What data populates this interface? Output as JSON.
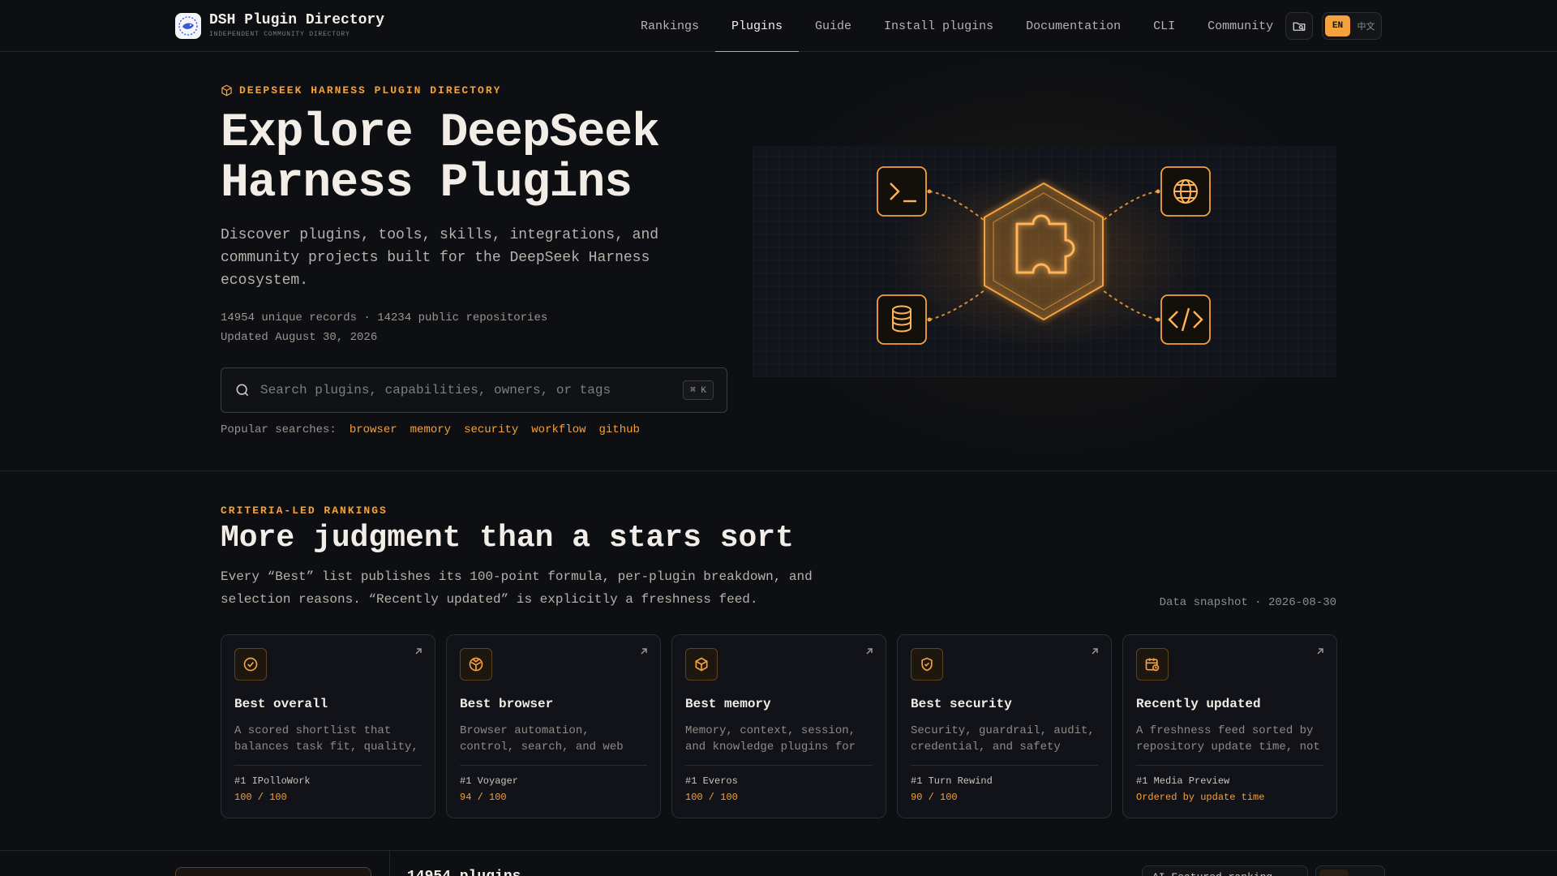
{
  "header": {
    "brand_title": "DSH Plugin Directory",
    "brand_subtitle": "INDEPENDENT COMMUNITY DIRECTORY",
    "nav": [
      {
        "label": "Rankings",
        "active": false
      },
      {
        "label": "Plugins",
        "active": true
      },
      {
        "label": "Guide",
        "active": false
      },
      {
        "label": "Install plugins",
        "active": false
      },
      {
        "label": "Documentation",
        "active": false
      },
      {
        "label": "CLI",
        "active": false
      },
      {
        "label": "Community",
        "active": false
      }
    ],
    "lang": {
      "active": "EN",
      "other": "中文"
    }
  },
  "hero": {
    "eyebrow": "DEEPSEEK HARNESS PLUGIN DIRECTORY",
    "title": "Explore DeepSeek Harness Plugins",
    "description": "Discover plugins, tools, skills, integrations, and community projects built for the DeepSeek Harness ecosystem.",
    "stats": "14954 unique records · 14234 public repositories",
    "updated": "Updated August 30, 2026",
    "search_placeholder": "Search plugins, capabilities, owners, or tags",
    "search_shortcut": "⌘ K",
    "popular_label": "Popular searches:",
    "popular": [
      "browser",
      "memory",
      "security",
      "workflow",
      "github"
    ]
  },
  "rankings": {
    "eyebrow": "CRITERIA-LED RANKINGS",
    "title": "More judgment than a stars sort",
    "description": "Every “Best” list publishes its 100-point formula, per-plugin breakdown, and selection reasons. “Recently updated” is explicitly a freshness feed.",
    "snapshot": "Data snapshot · 2026-08-30",
    "cards": [
      {
        "icon": "badge-check-icon",
        "title": "Best overall",
        "desc": "A scored shortlist that balances task fit, quality, and community signals.",
        "top": "#1 IPolloWork",
        "score": "100 / 100"
      },
      {
        "icon": "globe-box-icon",
        "title": "Best browser",
        "desc": "Browser automation, control, search, and web interaction plugins.",
        "top": "#1 Voyager",
        "score": "94 / 100"
      },
      {
        "icon": "cube-icon",
        "title": "Best memory",
        "desc": "Memory, context, session, and knowledge plugins for long-running work.",
        "top": "#1 Everos",
        "score": "100 / 100"
      },
      {
        "icon": "shield-check-icon",
        "title": "Best security",
        "desc": "Security, guardrail, audit, credential, and safety tooling.",
        "top": "#1 Turn Rewind",
        "score": "90 / 100"
      },
      {
        "icon": "calendar-clock-icon",
        "title": "Recently updated",
        "desc": "A freshness feed sorted by repository update time, not a ranking.",
        "top": "#1 Media Preview",
        "score": "Ordered by update time"
      }
    ]
  },
  "listing": {
    "count_label": "14954 plugins",
    "sort_label": "AI-Featured ranking"
  },
  "colors": {
    "accent": "#f5a13c",
    "background": "#0d0f12"
  }
}
